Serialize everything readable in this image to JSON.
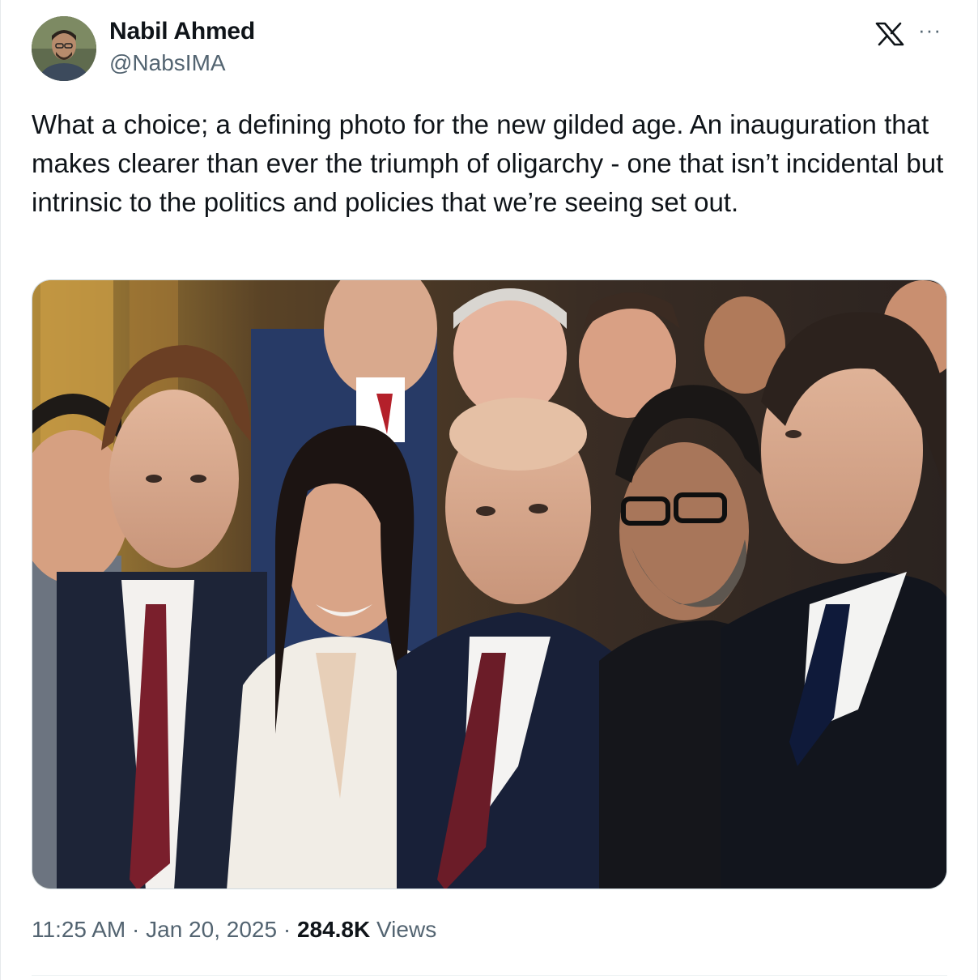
{
  "author": {
    "display_name": "Nabil Ahmed",
    "handle": "@NabsIMA"
  },
  "header_icons": {
    "logo": "x-logo-icon",
    "menu": "more-options-icon",
    "menu_glyph": "···"
  },
  "tweet": {
    "text": "What a choice; a defining photo for the new gilded age. An inauguration that makes clearer than ever the triumph of oligarchy - one that isn’t incidental but intrinsic to the politics and policies that we’re seeing set out."
  },
  "media": {
    "kind": "photo",
    "description_icon": "tweet-photo"
  },
  "meta": {
    "time": "11:25 AM",
    "separator": " · ",
    "date": "Jan 20, 2025",
    "views_count": "284.8K",
    "views_label": "Views"
  },
  "colors": {
    "text_primary": "#0f1419",
    "text_secondary": "#536471",
    "border": "#cfd9de"
  }
}
